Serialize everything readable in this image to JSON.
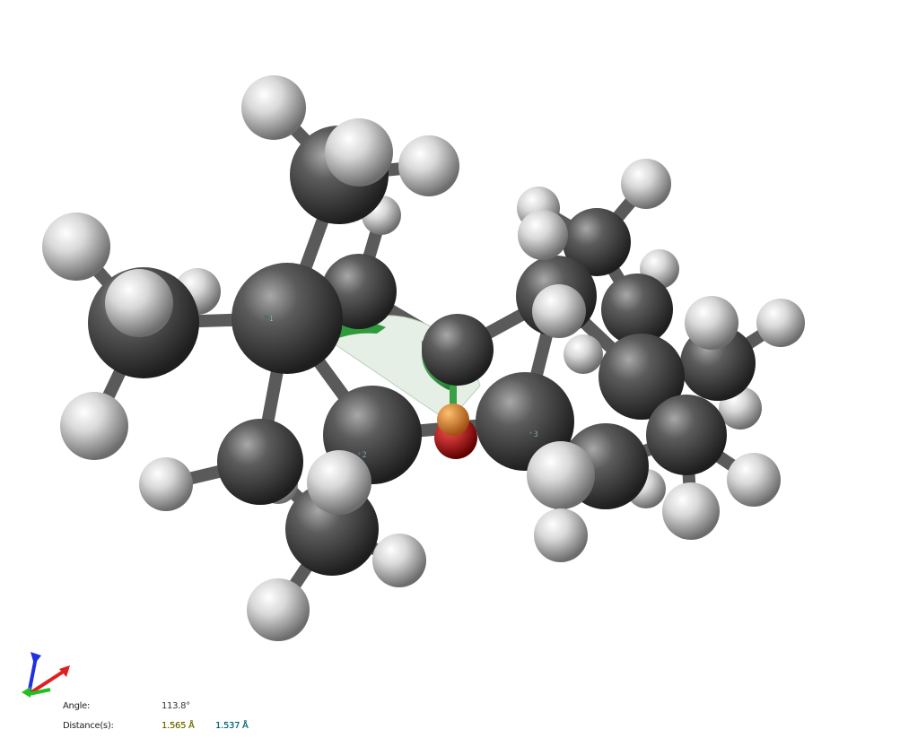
{
  "measurements": {
    "angle": {
      "label": "Angle:",
      "value": "113.8°"
    },
    "distances": {
      "label": "Distance(s):",
      "values": [
        "1.565 Å",
        "1.537 Å"
      ]
    }
  },
  "atom_labels": [
    "*1",
    "*2",
    "*3"
  ],
  "colors": {
    "background": "#ffffff",
    "carbon": "#4a4a4a",
    "hydrogen": "#e6e6e6",
    "bond": "#5a5a5a",
    "angle_arc": "#2f9a3c",
    "angle_fill": "#e6efe6",
    "axis_x": "#e02020",
    "axis_y": "#20c020",
    "axis_z": "#2030e0",
    "oxygen": "#c00000",
    "orange_marker": "#e08a2a"
  },
  "icons": [
    "axis-triad-icon"
  ]
}
